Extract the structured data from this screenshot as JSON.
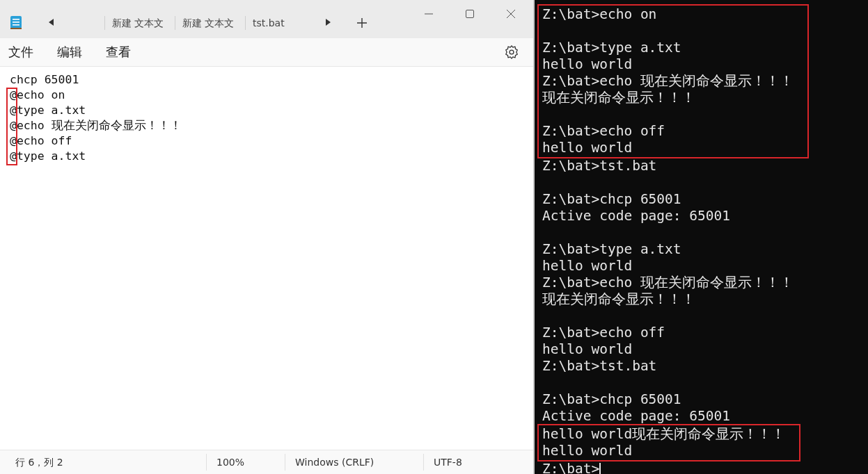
{
  "notepad": {
    "tabs": [
      {
        "label": "新建 文本文"
      },
      {
        "label": "新建 文本文"
      },
      {
        "label": "tst.bat"
      }
    ],
    "menu": [
      "文件",
      "编辑",
      "查看"
    ],
    "editor": {
      "lines": [
        {
          "text": "chcp 65001",
          "marked": false
        },
        {
          "text": "@echo on",
          "marked": true
        },
        {
          "text": "@type a.txt",
          "marked": true
        },
        {
          "text": "@echo 现在关闭命令显示！！！",
          "marked": true
        },
        {
          "text": "@echo off",
          "marked": true
        },
        {
          "text": "@type a.txt",
          "marked": true
        }
      ]
    },
    "status_bar": [
      "行 6，列 2",
      "100%",
      "Windows (CRLF)",
      "UTF-8"
    ]
  },
  "terminal": {
    "sections": [
      {
        "highlighted": true,
        "lines": [
          {
            "kind": "text",
            "text": "Z:\\bat>echo on"
          },
          {
            "kind": "blank"
          },
          {
            "kind": "text",
            "text": "Z:\\bat>type a.txt"
          },
          {
            "kind": "text",
            "text": "hello world"
          },
          {
            "kind": "text",
            "text": "Z:\\bat>echo 现在关闭命令显示！！！"
          },
          {
            "kind": "text",
            "text": "现在关闭命令显示！！！"
          },
          {
            "kind": "blank"
          },
          {
            "kind": "text",
            "text": "Z:\\bat>echo off"
          },
          {
            "kind": "text",
            "text": "hello world"
          }
        ]
      },
      {
        "highlighted": false,
        "lines": [
          {
            "kind": "text",
            "text": "Z:\\bat>tst.bat"
          },
          {
            "kind": "blank"
          },
          {
            "kind": "text",
            "text": "Z:\\bat>chcp 65001"
          },
          {
            "kind": "text",
            "text": "Active code page: 65001"
          },
          {
            "kind": "blank"
          },
          {
            "kind": "text",
            "text": "Z:\\bat>type a.txt"
          },
          {
            "kind": "text",
            "text": "hello world"
          },
          {
            "kind": "text",
            "text": "Z:\\bat>echo 现在关闭命令显示！！！"
          },
          {
            "kind": "text",
            "text": "现在关闭命令显示！！！"
          },
          {
            "kind": "blank"
          },
          {
            "kind": "text",
            "text": "Z:\\bat>echo off"
          },
          {
            "kind": "text",
            "text": "hello world"
          },
          {
            "kind": "text",
            "text": "Z:\\bat>tst.bat"
          },
          {
            "kind": "blank"
          },
          {
            "kind": "text",
            "text": "Z:\\bat>chcp 65001"
          },
          {
            "kind": "text",
            "text": "Active code page: 65001"
          }
        ]
      },
      {
        "highlighted": true,
        "lines": [
          {
            "kind": "text",
            "text": "hello world现在关闭命令显示！！！"
          },
          {
            "kind": "text",
            "text": "hello world"
          }
        ]
      },
      {
        "highlighted": false,
        "lines": [
          {
            "kind": "prompt",
            "text": "Z:\\bat>"
          }
        ]
      }
    ]
  }
}
